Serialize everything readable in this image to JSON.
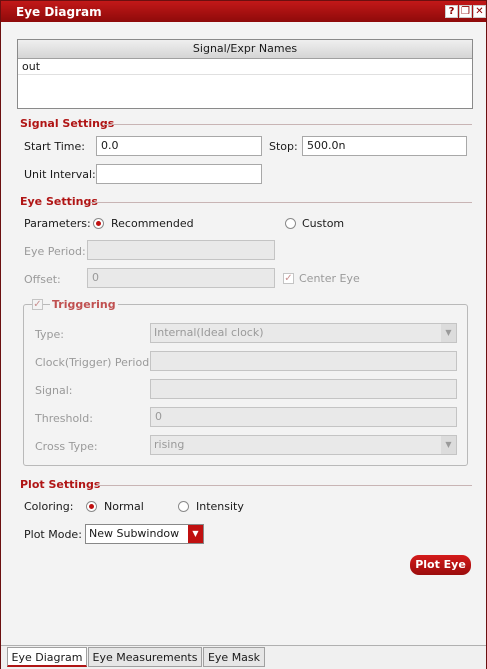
{
  "window": {
    "title": "Eye Diagram"
  },
  "signals": {
    "header": "Signal/Expr Names",
    "rows": [
      "out"
    ]
  },
  "signal_settings": {
    "title": "Signal Settings",
    "start_label": "Start Time:",
    "start_value": "0.0",
    "stop_label": "Stop:",
    "stop_value": "500.0n",
    "unit_label": "Unit Interval:",
    "unit_value": ""
  },
  "eye_settings": {
    "title": "Eye Settings",
    "params_label": "Parameters:",
    "recommended_label": "Recommended",
    "custom_label": "Custom",
    "selected": "Recommended",
    "period_label": "Eye Period:",
    "period_value": "",
    "offset_label": "Offset:",
    "offset_value": "0",
    "center_eye_label": "Center Eye",
    "center_eye_checked": true
  },
  "triggering": {
    "title": "Triggering",
    "checked": true,
    "type_label": "Type:",
    "type_value": "Internal(Ideal clock)",
    "clock_label": "Clock(Trigger) Period:",
    "clock_value": "",
    "signal_label": "Signal:",
    "signal_value": "",
    "threshold_label": "Threshold:",
    "threshold_value": "0",
    "cross_label": "Cross Type:",
    "cross_value": "rising"
  },
  "plot_settings": {
    "title": "Plot Settings",
    "coloring_label": "Coloring:",
    "normal_label": "Normal",
    "intensity_label": "Intensity",
    "selected": "Normal",
    "mode_label": "Plot Mode:",
    "mode_value": "New Subwindow",
    "plot_button": "Plot Eye"
  },
  "tabs": [
    "Eye Diagram",
    "Eye Measurements",
    "Eye Mask"
  ],
  "active_tab": "Eye Diagram",
  "colors": {
    "accent": "#b01515",
    "title_bar": "#a80f0f"
  },
  "icons": {
    "titlebar": [
      "help-icon",
      "restore-icon",
      "close-icon"
    ]
  }
}
